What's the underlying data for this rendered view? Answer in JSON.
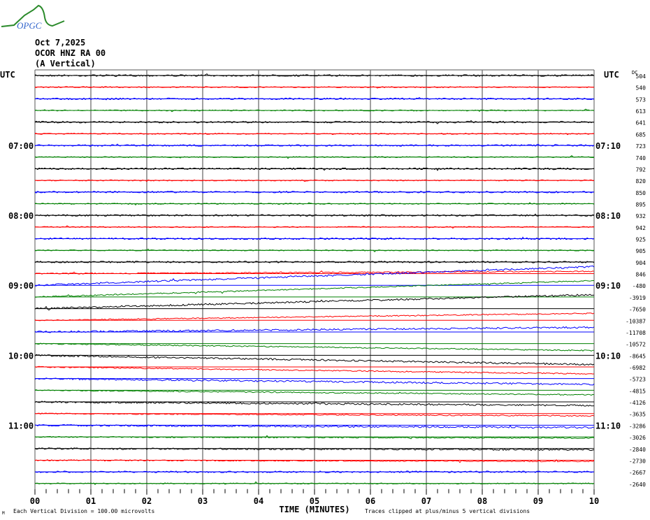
{
  "header": {
    "logo_text": "OPGC",
    "date": "Oct 7,2025",
    "station": "OCOR HNZ RA 00",
    "component": "(A Vertical)"
  },
  "colors": {
    "trace_cycle": [
      "#000000",
      "#ff0000",
      "#0000ff",
      "#008000"
    ],
    "grid": "#808080"
  },
  "chart_data": {
    "type": "line",
    "title": "OCOR HNZ RA 00 (A Vertical) helicorder, Oct 7,2025",
    "xlabel": "TIME (MINUTES)",
    "x_ticks": [
      "00",
      "01",
      "02",
      "03",
      "04",
      "05",
      "06",
      "07",
      "08",
      "09",
      "10"
    ],
    "xlim": [
      0,
      10
    ],
    "left_axis_title": "UTC",
    "right_axis_title": "UTC",
    "dc_label": "DC",
    "left_hour_labels": [
      {
        "row": 6,
        "label": "07:00"
      },
      {
        "row": 12,
        "label": "08:00"
      },
      {
        "row": 18,
        "label": "09:00"
      },
      {
        "row": 24,
        "label": "10:00"
      },
      {
        "row": 30,
        "label": "11:00"
      }
    ],
    "right_hour_labels": [
      {
        "row": 6,
        "label": "07:10"
      },
      {
        "row": 12,
        "label": "08:10"
      },
      {
        "row": 18,
        "label": "09:10"
      },
      {
        "row": 24,
        "label": "10:10"
      },
      {
        "row": 30,
        "label": "11:10"
      }
    ],
    "dc_offsets": [
      504,
      540,
      573,
      613,
      641,
      685,
      723,
      740,
      792,
      820,
      850,
      895,
      932,
      942,
      925,
      905,
      904,
      846,
      -480,
      -3919,
      -7650,
      -10387,
      -11708,
      -10572,
      -8645,
      -6982,
      -5723,
      -4815,
      -4126,
      -3635,
      -3286,
      -3026,
      -2840,
      -2730,
      -2667,
      -2640
    ],
    "row_drift_divisions": [
      0,
      0,
      0,
      0,
      0,
      0,
      0,
      0,
      0,
      0,
      0,
      0,
      0,
      0,
      0,
      0,
      0,
      0.2,
      1.6,
      1.4,
      1.2,
      0.6,
      0.4,
      -0.6,
      -0.8,
      -0.6,
      -0.5,
      -0.4,
      -0.3,
      -0.2,
      -0.2,
      -0.1,
      -0.1,
      -0.1,
      0,
      0
    ],
    "footer_left": "Each Vertical Division =  100.00 microvolts",
    "footer_right": "Traces clipped at plus/minus 5 vertical divisions",
    "corner_mark": "M"
  }
}
